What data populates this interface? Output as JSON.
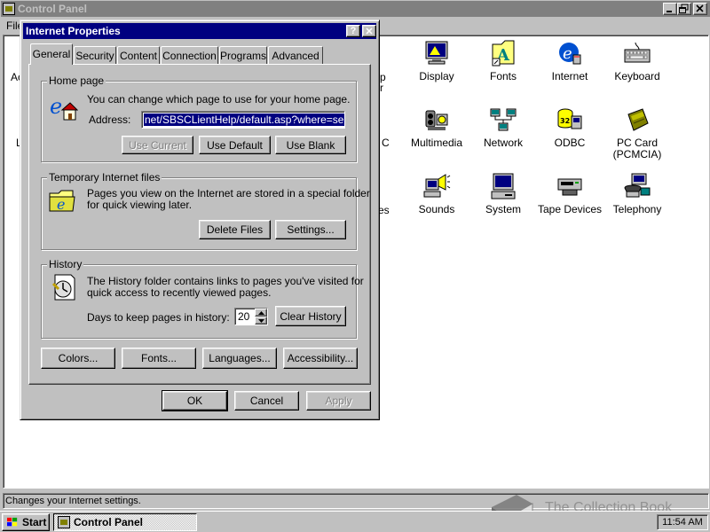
{
  "control_panel": {
    "title": "Control Panel",
    "menu_file": "File",
    "status_text": "Changes your Internet settings.",
    "hidden_labels": [
      "Ac",
      "L",
      "p",
      "r",
      "C",
      "es"
    ],
    "icons": [
      {
        "label": "Display",
        "icon": "display-icon"
      },
      {
        "label": "Fonts",
        "icon": "fonts-icon"
      },
      {
        "label": "Internet",
        "icon": "internet-icon"
      },
      {
        "label": "Keyboard",
        "icon": "keyboard-icon"
      },
      {
        "label": "Multimedia",
        "icon": "multimedia-icon"
      },
      {
        "label": "Network",
        "icon": "network-icon"
      },
      {
        "label": "ODBC",
        "icon": "odbc-icon"
      },
      {
        "label": "PC Card",
        "label2": "(PCMCIA)",
        "icon": "pc-card-icon"
      },
      {
        "label": "Sounds",
        "icon": "sounds-icon"
      },
      {
        "label": "System",
        "icon": "system-icon"
      },
      {
        "label": "Tape Devices",
        "icon": "tape-devices-icon"
      },
      {
        "label": "Telephony",
        "icon": "telephony-icon"
      }
    ]
  },
  "dialog": {
    "title": "Internet Properties",
    "help_label": "?",
    "close_label": "✕",
    "tabs": [
      "General",
      "Security",
      "Content",
      "Connection",
      "Programs",
      "Advanced"
    ],
    "home_page": {
      "group_title": "Home page",
      "description": "You can change which page to use for your home page.",
      "address_label": "Address:",
      "address_value": "net/SBSCLientHelp/default.asp?where=server",
      "use_current": "Use Current",
      "use_default": "Use Default",
      "use_blank": "Use Blank"
    },
    "temp_files": {
      "group_title": "Temporary Internet files",
      "description_line1": "Pages you view on the Internet are stored in a special folder",
      "description_line2": "for quick viewing later.",
      "delete_files": "Delete Files",
      "settings": "Settings..."
    },
    "history": {
      "group_title": "History",
      "description_line1": "The History folder contains links to pages you've visited for",
      "description_line2": "quick access to recently viewed pages.",
      "days_label": "Days to keep pages in history:",
      "days_value": "20",
      "clear_history": "Clear History"
    },
    "bottom_buttons": {
      "colors": "Colors...",
      "fonts": "Fonts...",
      "languages": "Languages...",
      "accessibility": "Accessibility..."
    },
    "ok": "OK",
    "cancel": "Cancel",
    "apply": "Apply"
  },
  "taskbar": {
    "start_label": "Start",
    "task_label": "Control Panel",
    "clock": "11:54 AM"
  },
  "watermark": {
    "text": "The Collection Book"
  },
  "colors": {
    "active_title": "#000080",
    "inactive_title": "#808080",
    "face": "#c0c0c0"
  }
}
